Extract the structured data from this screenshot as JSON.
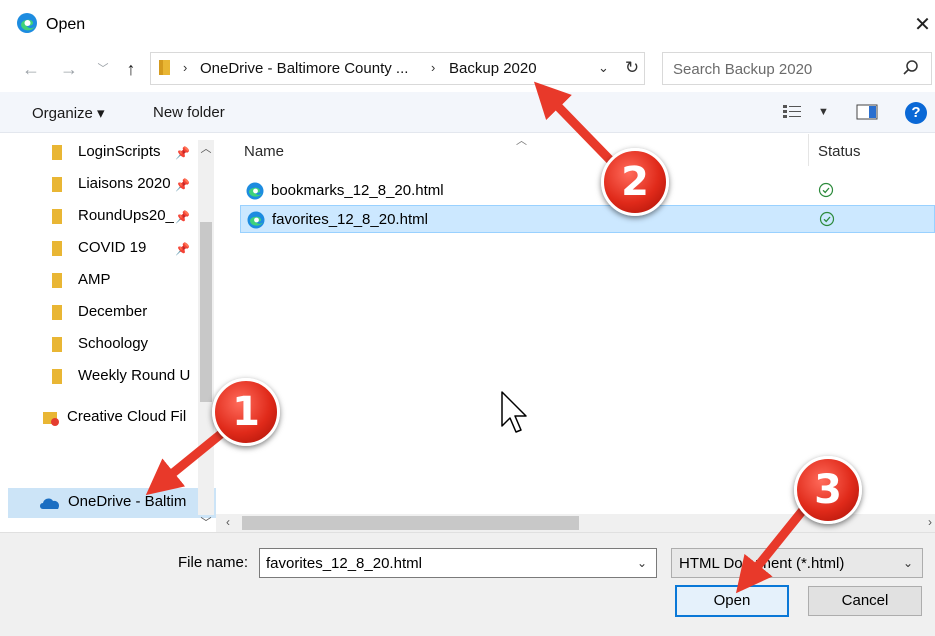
{
  "window": {
    "title": "Open",
    "close_glyph": "✕"
  },
  "address": {
    "crumbs": [
      "OneDrive - Baltimore County ...",
      "Backup 2020"
    ],
    "search_placeholder": "Search Backup 2020"
  },
  "toolbar": {
    "organize": "Organize ▾",
    "new_folder": "New folder",
    "help": "?"
  },
  "nav": {
    "items": [
      {
        "label": "LoginScripts",
        "pinned": true
      },
      {
        "label": "Liaisons 2020",
        "pinned": true
      },
      {
        "label": "RoundUps20_",
        "pinned": true
      },
      {
        "label": "COVID 19",
        "pinned": true
      },
      {
        "label": "AMP",
        "pinned": false
      },
      {
        "label": "December",
        "pinned": false
      },
      {
        "label": "Schoology",
        "pinned": false
      },
      {
        "label": "Weekly Round U",
        "pinned": false
      }
    ],
    "creative_cloud": "Creative Cloud Fil",
    "onedrive": "OneDrive - Baltim"
  },
  "files": {
    "columns": {
      "name": "Name",
      "status": "Status"
    },
    "rows": [
      {
        "name": "bookmarks_12_8_20.html",
        "selected": false
      },
      {
        "name": "favorites_12_8_20.html",
        "selected": true
      }
    ]
  },
  "footer": {
    "file_name_label": "File name:",
    "file_name_value": "favorites_12_8_20.html",
    "file_type": "HTML Document (*.html)",
    "open": "Open",
    "cancel": "Cancel"
  },
  "annotations": {
    "badges": [
      "1",
      "2",
      "3"
    ]
  },
  "colors": {
    "accent": "#0a78d7",
    "selection": "#cce8ff",
    "annotation": "#e02a1a",
    "folder": "#e9b634"
  }
}
